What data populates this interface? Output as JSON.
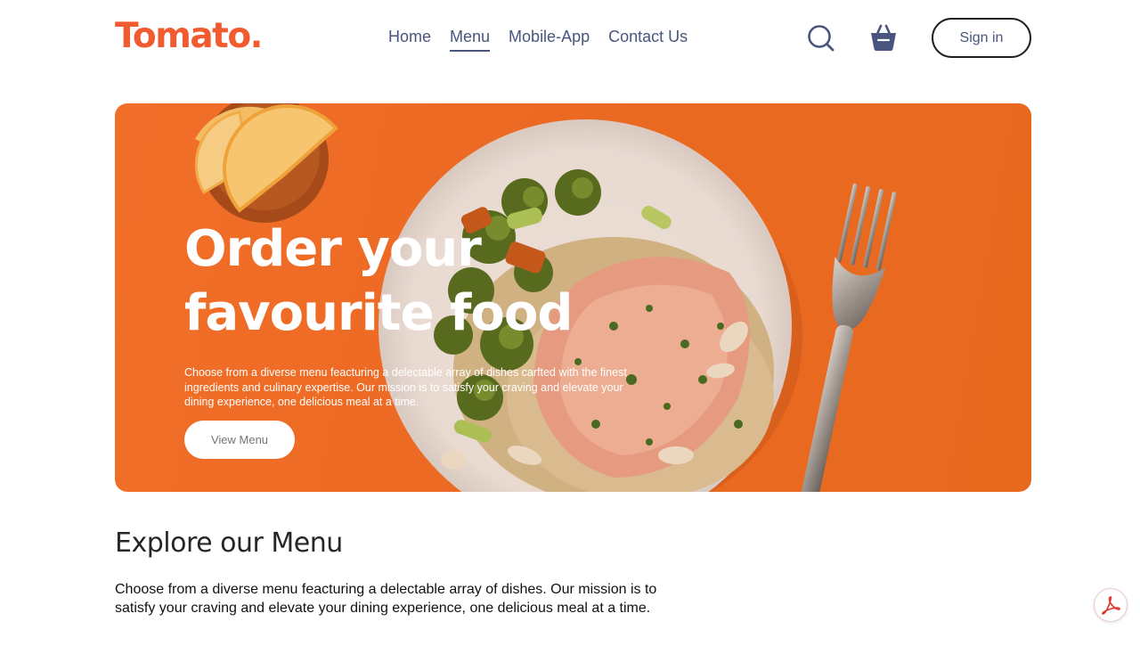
{
  "brand": {
    "logo_text": "Tomato.",
    "logo_color": "#f25a30"
  },
  "nav": {
    "items": [
      {
        "label": "Home",
        "active": false
      },
      {
        "label": "Menu",
        "active": true
      },
      {
        "label": "Mobile-App",
        "active": false
      },
      {
        "label": "Contact Us",
        "active": false
      }
    ],
    "search_icon": "search-icon",
    "basket_icon": "basket-icon",
    "signin_label": "Sign in"
  },
  "hero": {
    "title_line1": "Order your",
    "title_line2": "favourite food",
    "text": "Choose from a diverse menu feacturing a delectable array of dishes carfted with the finest ingredients and culinary expertise. Our mission is to satisfy your craving and elevate your dining experience, one delicious meal at a time.",
    "button_label": "View Menu",
    "background_color": "#ec6a23"
  },
  "explore": {
    "title": "Explore our Menu",
    "text": "Choose from a diverse menu feacturing a delectable array of dishes. Our mission is to satisfy your craving and elevate your dining experience, one delicious meal at a time."
  },
  "floating": {
    "pdf_icon": "pdf-icon"
  },
  "colors": {
    "nav_text": "#49557e",
    "accent": "#f25a30"
  }
}
